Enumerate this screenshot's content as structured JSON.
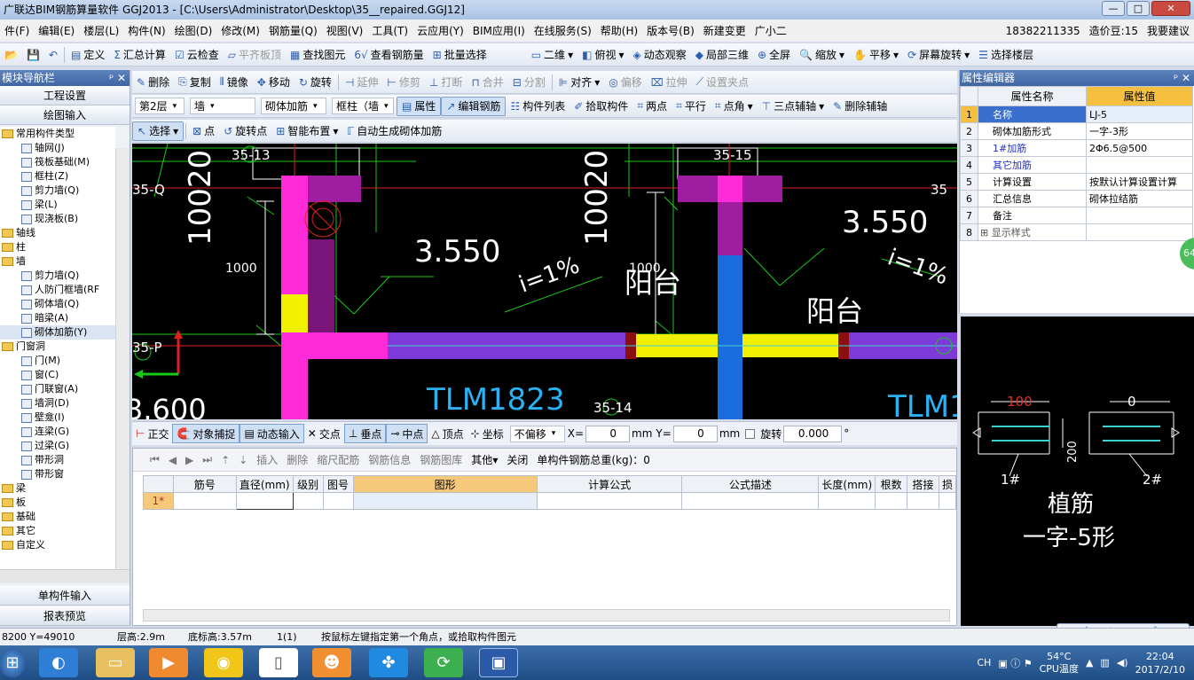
{
  "title_bar": {
    "text": "广联达BIM钢筋算量软件 GGJ2013 - [C:\\Users\\Administrator\\Desktop\\35__repaired.GGJ12]",
    "min": "—",
    "max": "□",
    "close": "✕"
  },
  "menu": [
    "件(F)",
    "编辑(E)",
    "楼层(L)",
    "构件(N)",
    "绘图(D)",
    "修改(M)",
    "钢筋量(Q)",
    "视图(V)",
    "工具(T)",
    "云应用(Y)",
    "BIM应用(I)",
    "在线服务(S)",
    "帮助(H)",
    "版本号(B)",
    "新建变更",
    "广小二"
  ],
  "account": {
    "phone": "18382211335",
    "price_bean": "造价豆:15",
    "suggest": "我要建议"
  },
  "toolbar1": [
    "定义",
    "汇总计算",
    "云检查",
    "平齐板顶",
    "查找图元",
    "查看钢筋量",
    "批量选择",
    "二维",
    "俯视",
    "动态观察",
    "局部三维",
    "全屏",
    "缩放",
    "平移",
    "屏幕旋转",
    "选择楼层"
  ],
  "toolbar2": [
    "删除",
    "复制",
    "镜像",
    "移动",
    "旋转",
    "延伸",
    "修剪",
    "打断",
    "合并",
    "分割",
    "对齐",
    "偏移",
    "拉伸",
    "设置夹点"
  ],
  "toolbar3": {
    "floor": "第2层",
    "type": "墙",
    "sub": "砌体加筋",
    "comp": "框柱（墙",
    "buttons": [
      "属性",
      "编辑钢筋",
      "构件列表",
      "拾取构件",
      "两点",
      "平行",
      "点角",
      "三点辅轴",
      "删除辅轴"
    ]
  },
  "toolbar4": [
    "选择",
    "点",
    "旋转点",
    "智能布置",
    "自动生成砌体加筋"
  ],
  "nav": {
    "title": "模块导航栏",
    "top_buttons": [
      "工程设置",
      "绘图输入"
    ],
    "tree": [
      {
        "t": "常用构件类型",
        "lvl": 0,
        "folder": true
      },
      {
        "t": "轴网(J)",
        "lvl": 1
      },
      {
        "t": "筏板基础(M)",
        "lvl": 1
      },
      {
        "t": "框柱(Z)",
        "lvl": 1
      },
      {
        "t": "剪力墙(Q)",
        "lvl": 1
      },
      {
        "t": "梁(L)",
        "lvl": 1
      },
      {
        "t": "现浇板(B)",
        "lvl": 1
      },
      {
        "t": "轴线",
        "lvl": 0,
        "folder": true
      },
      {
        "t": "柱",
        "lvl": 0,
        "folder": true
      },
      {
        "t": "墙",
        "lvl": 0,
        "folder": true
      },
      {
        "t": "剪力墙(Q)",
        "lvl": 1
      },
      {
        "t": "人防门框墙(RF",
        "lvl": 1
      },
      {
        "t": "砌体墙(Q)",
        "lvl": 1
      },
      {
        "t": "暗梁(A)",
        "lvl": 1
      },
      {
        "t": "砌体加筋(Y)",
        "lvl": 1,
        "sel": true
      },
      {
        "t": "门窗洞",
        "lvl": 0,
        "folder": true
      },
      {
        "t": "门(M)",
        "lvl": 1
      },
      {
        "t": "窗(C)",
        "lvl": 1
      },
      {
        "t": "门联窗(A)",
        "lvl": 1
      },
      {
        "t": "墙洞(D)",
        "lvl": 1
      },
      {
        "t": "壁龛(I)",
        "lvl": 1
      },
      {
        "t": "连梁(G)",
        "lvl": 1
      },
      {
        "t": "过梁(G)",
        "lvl": 1
      },
      {
        "t": "带形洞",
        "lvl": 1
      },
      {
        "t": "带形窗",
        "lvl": 1
      },
      {
        "t": "梁",
        "lvl": 0,
        "folder": true
      },
      {
        "t": "板",
        "lvl": 0,
        "folder": true
      },
      {
        "t": "基础",
        "lvl": 0,
        "folder": true
      },
      {
        "t": "其它",
        "lvl": 0,
        "folder": true
      },
      {
        "t": "自定义",
        "lvl": 0,
        "folder": true
      }
    ],
    "bottom_buttons": [
      "单构件输入",
      "报表预览"
    ]
  },
  "canvas": {
    "labels": {
      "a": "35-13",
      "b": "35-15",
      "c": "35-Q",
      "d": "35-P",
      "e": "35-14",
      "f": "35",
      "g": "10020",
      "h": "10020",
      "i": "3.550",
      "j": "3.550",
      "k": "i=1%",
      "l": "i=1%",
      "m": "阳台",
      "n": "阳台",
      "o": "1000",
      "p": "1000",
      "q": "TLM1823",
      "r": "TLM1",
      "s": "3.600"
    }
  },
  "coordbar": {
    "items": [
      "正交",
      "对象捕捉",
      "动态输入",
      "交点",
      "垂点",
      "中点",
      "顶点",
      "坐标"
    ],
    "offset": "不偏移",
    "x_label": "X=",
    "x": "0",
    "y_label": "Y=",
    "y": "0",
    "unit": "mm",
    "rotate": "旋转",
    "angle": "0.000",
    "deg": "°"
  },
  "grid": {
    "tools": [
      "插入",
      "删除",
      "缩尺配筋",
      "钢筋信息",
      "钢筋图库",
      "其他",
      "关闭"
    ],
    "total": "单构件钢筋总重(kg)：0",
    "headers": [
      "筋号",
      "直径(mm)",
      "级别",
      "图号",
      "图形",
      "计算公式",
      "公式描述",
      "长度(mm)",
      "根数",
      "搭接",
      "损"
    ],
    "row1": "1*"
  },
  "props": {
    "title": "属性编辑器",
    "col_name": "属性名称",
    "col_value": "属性值",
    "rows": [
      {
        "n": "1",
        "name": "名称",
        "value": "LJ-5"
      },
      {
        "n": "2",
        "name": "砌体加筋形式",
        "value": "一字-3形"
      },
      {
        "n": "3",
        "name": "1#加筋",
        "value": "2Φ6.5@500"
      },
      {
        "n": "4",
        "name": "其它加筋",
        "value": ""
      },
      {
        "n": "5",
        "name": "计算设置",
        "value": "按默认计算设置计算"
      },
      {
        "n": "6",
        "name": "汇总信息",
        "value": "砌体拉结筋"
      },
      {
        "n": "7",
        "name": "备注",
        "value": ""
      },
      {
        "n": "8",
        "name": "显示样式",
        "value": ""
      }
    ]
  },
  "preview": {
    "dim1": "100",
    "dim2": "0",
    "dim3": "200",
    "bar1": "1#",
    "bar2": "2#",
    "name1": "植筋",
    "name2": "一字-5形",
    "badge": "64"
  },
  "status": {
    "xy": "8200 Y=49010",
    "floor_h": "层高:2.9m",
    "base_h": "底标高:3.57m",
    "count": "1(1)",
    "hint": "按鼠标左键指定第一个角点，或拾取构件图元"
  },
  "ime": "中 ☽ °, ⌨ ✎ 🔧",
  "tray": {
    "temp": "54°C",
    "cpu": "CPU温度",
    "time": "22:04",
    "date": "2017/2/10",
    "lang": "CH"
  }
}
